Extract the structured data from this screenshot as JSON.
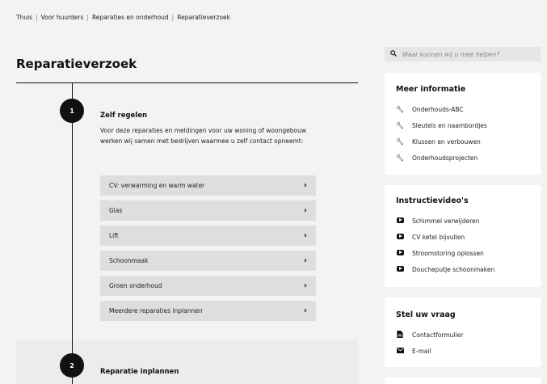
{
  "breadcrumb": {
    "items": [
      "Thuis",
      "Voor huurders",
      "Reparaties en onderhoud",
      "Reparatieverzoek"
    ],
    "separator": "|"
  },
  "page": {
    "title": "Reparatieverzoek"
  },
  "steps": [
    {
      "number": "1",
      "title": "Zelf regelen",
      "description": "Voor deze reparaties en meldingen voor uw woning of woongebouw werken wij samen met bedrijven waarmee u zelf contact opneemt:",
      "options": [
        "CV: verwarming en warm water",
        "Glas",
        "Lift",
        "Schoonmaak",
        "Groen onderhoud",
        "Meerdere reparaties inplannen"
      ]
    },
    {
      "number": "2",
      "title": "Reparatie inplannen"
    }
  ],
  "search": {
    "placeholder": "Waar kunnen wij u mee helpen?",
    "icon": "search-icon"
  },
  "sidebar": {
    "more_info": {
      "title": "Meer informatie",
      "icon": "wrench-icon",
      "links": [
        "Onderhouds-ABC",
        "Sleutels en naambordjes",
        "Klussen en verbouwen",
        "Onderhoudsprojecten"
      ]
    },
    "videos": {
      "title": "Instructievideo's",
      "icon": "video-play-icon",
      "links": [
        "Schimmel verwijderen",
        "CV ketel bijvullen",
        "Stroomstoring oplossen",
        "Doucheputje schoonmaken"
      ]
    },
    "ask": {
      "title": "Stel uw vraag",
      "links": [
        {
          "label": "Contactformulier",
          "icon": "document-icon"
        },
        {
          "label": "E-mail",
          "icon": "envelope-icon"
        }
      ]
    }
  },
  "colors": {
    "background": "#f3f3f3",
    "option_bg": "#dedede",
    "text": "#111111",
    "card_bg": "#ffffff"
  }
}
